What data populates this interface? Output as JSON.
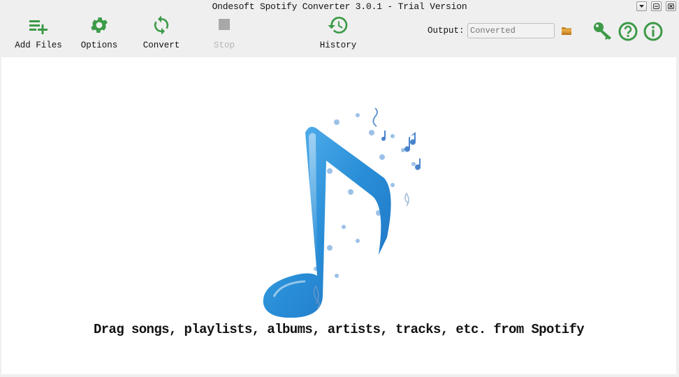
{
  "window": {
    "title": "Ondesoft Spotify Converter 3.0.1 - Trial Version",
    "controls": [
      {
        "name": "menu-dropdown",
        "icon": "triangle-down-icon"
      },
      {
        "name": "minimize",
        "icon": "minimize-icon"
      },
      {
        "name": "close",
        "icon": "close-icon"
      }
    ]
  },
  "toolbar": {
    "add_files": {
      "label": "Add Files",
      "icon": "playlist-add-icon",
      "enabled": true
    },
    "options": {
      "label": "Options",
      "icon": "gear-icon",
      "enabled": true
    },
    "convert": {
      "label": "Convert",
      "icon": "refresh-icon",
      "enabled": true
    },
    "stop": {
      "label": "Stop",
      "icon": "stop-square-icon",
      "enabled": false
    },
    "history": {
      "label": "History",
      "icon": "history-icon",
      "enabled": true
    }
  },
  "output": {
    "label": "Output:",
    "value": "",
    "placeholder": "Converted",
    "browse_icon": "folder-icon"
  },
  "right_icons": [
    {
      "name": "register",
      "icon": "key-icon"
    },
    {
      "name": "help",
      "icon": "help-circle-icon"
    },
    {
      "name": "about",
      "icon": "info-circle-icon"
    }
  ],
  "main": {
    "illustration": "blue-music-note-icon",
    "drop_hint": "Drag songs, playlists, albums, artists, tracks, etc. from Spotify"
  },
  "colors": {
    "accent_green": "#3c9a47",
    "disabled_gray": "#a8a8a8",
    "toolbar_bg": "#efefef",
    "content_bg": "#ffffff",
    "note_blue": "#2a8fd8"
  }
}
